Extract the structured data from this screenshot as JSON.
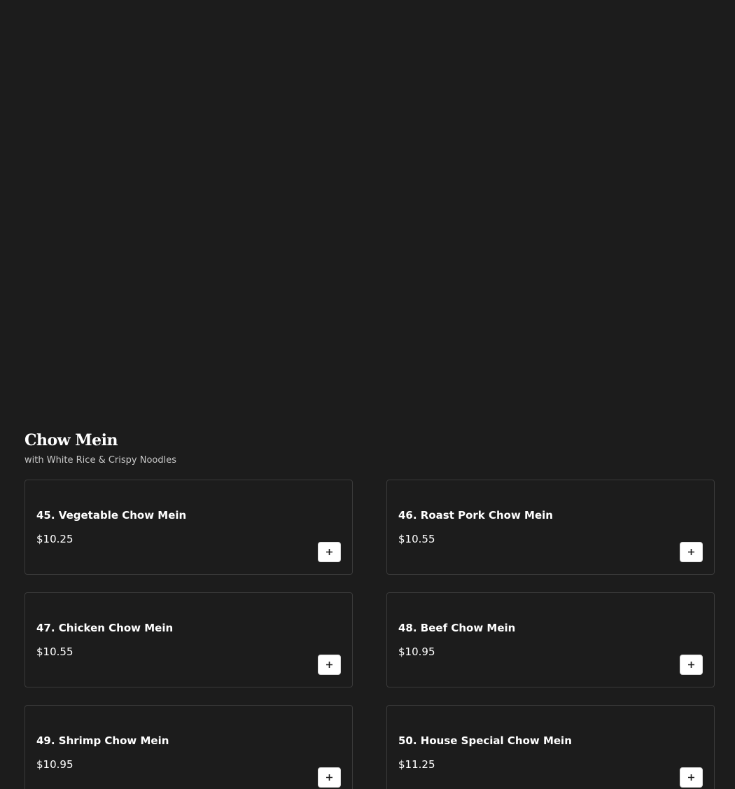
{
  "section": {
    "title": "Chow Mein",
    "subtitle": "with White Rice & Crispy Noodles"
  },
  "items": [
    {
      "name": "45. Vegetable Chow Mein",
      "price": "$10.25"
    },
    {
      "name": "46. Roast Pork Chow Mein",
      "price": "$10.55"
    },
    {
      "name": "47. Chicken Chow Mein",
      "price": "$10.55"
    },
    {
      "name": "48. Beef Chow Mein",
      "price": "$10.95"
    },
    {
      "name": "49. Shrimp Chow Mein",
      "price": "$10.95"
    },
    {
      "name": "50. House Special Chow Mein",
      "price": "$11.25"
    }
  ],
  "icons": {
    "add": "plus-icon"
  },
  "colors": {
    "background": "#1c1c1c",
    "card_border": "#3a3a3a",
    "text": "#ffffff",
    "subtitle": "#c9c9c9",
    "button_bg": "#ffffff"
  }
}
